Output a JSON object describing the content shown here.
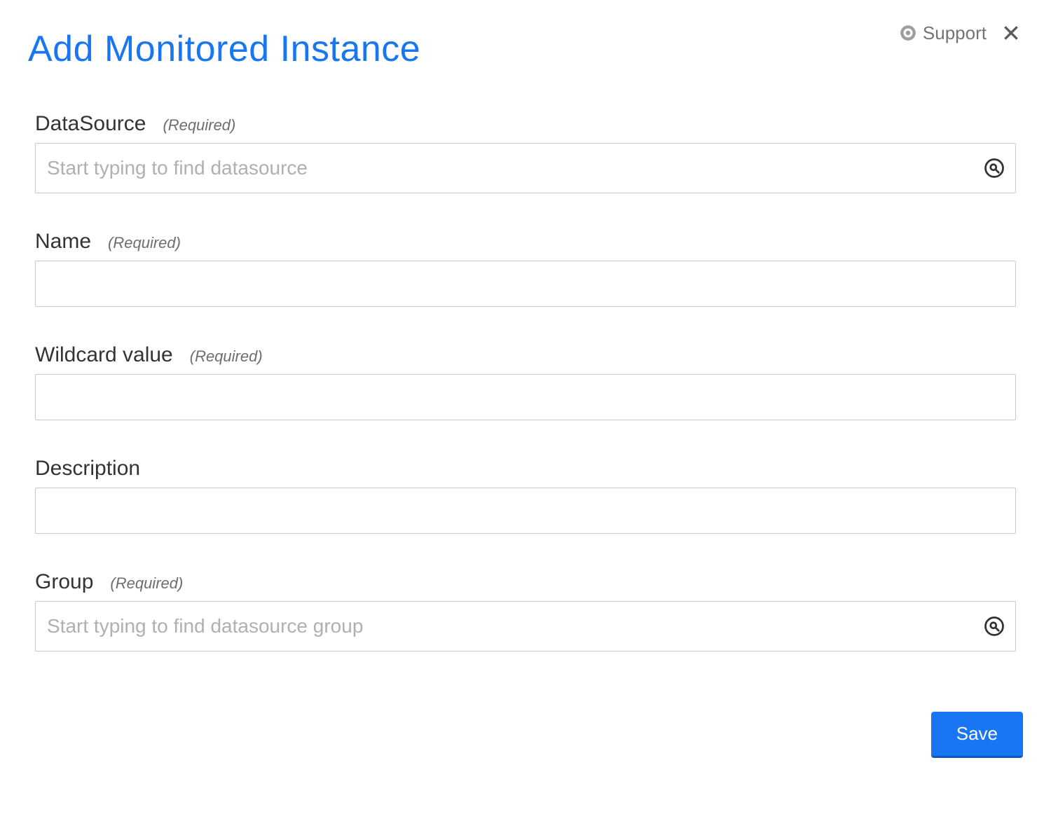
{
  "header": {
    "title": "Add Monitored Instance",
    "support_label": "Support"
  },
  "fields": {
    "datasource": {
      "label": "DataSource",
      "required_hint": "(Required)",
      "placeholder": "Start typing to find datasource",
      "value": ""
    },
    "name": {
      "label": "Name",
      "required_hint": "(Required)",
      "value": ""
    },
    "wildcard": {
      "label": "Wildcard value",
      "required_hint": "(Required)",
      "value": ""
    },
    "description": {
      "label": "Description",
      "value": ""
    },
    "group": {
      "label": "Group",
      "required_hint": "(Required)",
      "placeholder": "Start typing to find datasource group",
      "value": ""
    }
  },
  "footer": {
    "save_label": "Save"
  }
}
